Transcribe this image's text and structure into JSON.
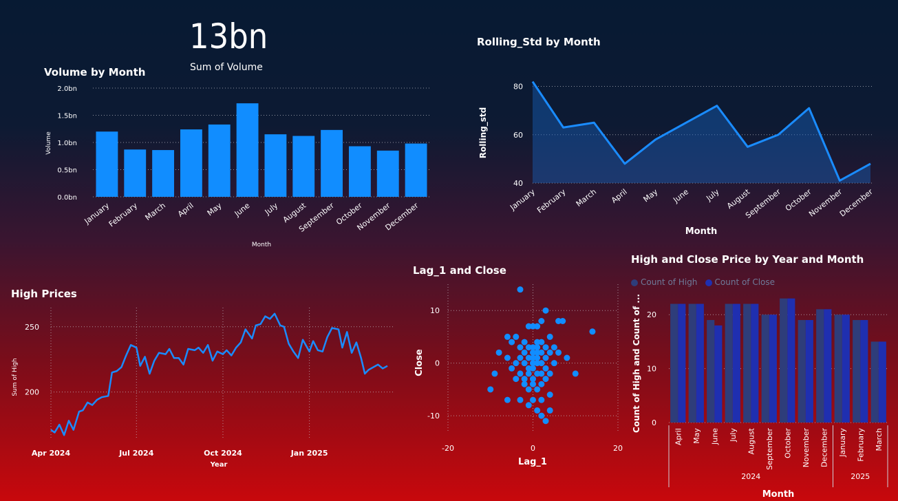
{
  "card": {
    "value": "13bn",
    "label": "Sum of Volume"
  },
  "volume_chart": {
    "title": "Volume by Month",
    "xlabel": "Month",
    "ylabel": "Volume",
    "yticks": [
      "0.0bn",
      "0.5bn",
      "1.0bn",
      "1.5bn",
      "2.0bn"
    ]
  },
  "rolling_chart": {
    "title": "Rolling_Std by Month",
    "xlabel": "Month",
    "ylabel": "Rolling_std",
    "yticks": [
      "40",
      "60",
      "80"
    ]
  },
  "high_chart": {
    "title": "High Prices",
    "xlabel": "Year",
    "ylabel": "Sum of High",
    "yticks": [
      "200",
      "250"
    ],
    "xticks": [
      "Apr 2024",
      "Jul 2024",
      "Oct 2024",
      "Jan 2025"
    ]
  },
  "scatter_chart": {
    "title": "Lag_1 and Close",
    "xlabel": "Lag_1",
    "ylabel": "Close",
    "yticks": [
      "10",
      "0",
      "-10"
    ],
    "xticks": [
      "-20",
      "0",
      "20"
    ]
  },
  "hc_chart": {
    "title": "High and Close Price by Year and Month",
    "xlabel": "Month",
    "ylabel": "Count of High and Count of ...",
    "legend": [
      "Count of High",
      "Count of Close"
    ],
    "yticks": [
      "0",
      "10",
      "20"
    ],
    "years": [
      "2024",
      "2025"
    ]
  },
  "colors": {
    "bar": "#118dff",
    "high": "#2e3d7a",
    "close": "#1f2fb0"
  },
  "chart_data": [
    {
      "type": "bar",
      "title": "Volume by Month",
      "categories": [
        "January",
        "February",
        "March",
        "April",
        "May",
        "June",
        "July",
        "August",
        "September",
        "October",
        "November",
        "December"
      ],
      "values": [
        1.2,
        0.87,
        0.86,
        1.24,
        1.33,
        1.72,
        1.15,
        1.12,
        1.23,
        0.93,
        0.85,
        0.98
      ],
      "xlabel": "Month",
      "ylabel": "Volume",
      "ylim": [
        0,
        2.0
      ],
      "unit": "bn"
    },
    {
      "type": "area",
      "title": "Rolling_Std by Month",
      "categories": [
        "January",
        "February",
        "March",
        "April",
        "May",
        "June",
        "July",
        "August",
        "September",
        "October",
        "November",
        "December"
      ],
      "values": [
        82,
        63,
        65,
        48,
        58,
        65,
        72,
        55,
        60,
        71,
        41,
        48
      ],
      "xlabel": "Month",
      "ylabel": "Rolling_std",
      "ylim": [
        40,
        85
      ]
    },
    {
      "type": "line",
      "title": "High Prices",
      "x": [
        "2024-04-01",
        "2024-04-05",
        "2024-04-10",
        "2024-04-15",
        "2024-04-20",
        "2024-04-25",
        "2024-05-01",
        "2024-05-05",
        "2024-05-10",
        "2024-05-15",
        "2024-05-20",
        "2024-05-25",
        "2024-06-01",
        "2024-06-05",
        "2024-06-10",
        "2024-06-15",
        "2024-06-20",
        "2024-06-25",
        "2024-07-01",
        "2024-07-05",
        "2024-07-10",
        "2024-07-15",
        "2024-07-20",
        "2024-07-25",
        "2024-08-01",
        "2024-08-05",
        "2024-08-10",
        "2024-08-15",
        "2024-08-20",
        "2024-08-25",
        "2024-09-01",
        "2024-09-05",
        "2024-09-10",
        "2024-09-15",
        "2024-09-20",
        "2024-09-25",
        "2024-10-01",
        "2024-10-05",
        "2024-10-10",
        "2024-10-15",
        "2024-10-20",
        "2024-10-25",
        "2024-11-01",
        "2024-11-05",
        "2024-11-10",
        "2024-11-15",
        "2024-11-20",
        "2024-11-25",
        "2024-12-01",
        "2024-12-05",
        "2024-12-10",
        "2024-12-15",
        "2024-12-20",
        "2024-12-25",
        "2025-01-01",
        "2025-01-05",
        "2025-01-10",
        "2025-01-15",
        "2025-01-20",
        "2025-01-25",
        "2025-02-01",
        "2025-02-05",
        "2025-02-10",
        "2025-02-15",
        "2025-02-20",
        "2025-02-25",
        "2025-03-01",
        "2025-03-05",
        "2025-03-10",
        "2025-03-15",
        "2025-03-20",
        "2025-03-25"
      ],
      "y": [
        171,
        169,
        175,
        167,
        178,
        171,
        185,
        186,
        192,
        190,
        194,
        196,
        197,
        215,
        216,
        219,
        228,
        236,
        234,
        220,
        227,
        214,
        224,
        230,
        229,
        233,
        226,
        226,
        221,
        233,
        232,
        234,
        230,
        236,
        224,
        231,
        229,
        232,
        228,
        234,
        238,
        248,
        241,
        251,
        252,
        258,
        256,
        260,
        251,
        250,
        237,
        231,
        226,
        240,
        231,
        239,
        232,
        231,
        242,
        249,
        248,
        234,
        246,
        230,
        238,
        226,
        214,
        217,
        219,
        221,
        218,
        220
      ],
      "xlabel": "Year",
      "ylabel": "Sum of High",
      "ylim": [
        165,
        262
      ]
    },
    {
      "type": "scatter",
      "title": "Lag_1 and Close",
      "points": [
        [
          -3,
          14
        ],
        [
          3,
          10
        ],
        [
          2,
          8
        ],
        [
          6,
          8
        ],
        [
          -1,
          7
        ],
        [
          0,
          7
        ],
        [
          1,
          7
        ],
        [
          4,
          5
        ],
        [
          -4,
          5
        ],
        [
          -5,
          4
        ],
        [
          -2,
          4
        ],
        [
          1,
          4
        ],
        [
          2,
          4
        ],
        [
          3,
          3
        ],
        [
          -3,
          3
        ],
        [
          -1,
          3
        ],
        [
          0,
          3
        ],
        [
          1,
          3
        ],
        [
          5,
          3
        ],
        [
          6,
          2
        ],
        [
          -2,
          2
        ],
        [
          0,
          2
        ],
        [
          1,
          2
        ],
        [
          2,
          2
        ],
        [
          4,
          2
        ],
        [
          -6,
          1
        ],
        [
          -3,
          1
        ],
        [
          -1,
          1
        ],
        [
          0,
          1
        ],
        [
          1,
          1
        ],
        [
          3,
          1
        ],
        [
          -4,
          0
        ],
        [
          -2,
          0
        ],
        [
          0,
          0
        ],
        [
          1,
          0
        ],
        [
          2,
          0
        ],
        [
          5,
          0
        ],
        [
          -5,
          -1
        ],
        [
          -1,
          -1
        ],
        [
          0,
          -1
        ],
        [
          3,
          -1
        ],
        [
          -3,
          -2
        ],
        [
          -1,
          -2
        ],
        [
          1,
          -2
        ],
        [
          2,
          -2
        ],
        [
          4,
          -2
        ],
        [
          -4,
          -3
        ],
        [
          -2,
          -3
        ],
        [
          0,
          -3
        ],
        [
          3,
          -3
        ],
        [
          -2,
          -4
        ],
        [
          0,
          -4
        ],
        [
          2,
          -4
        ],
        [
          -1,
          -5
        ],
        [
          1,
          -5
        ],
        [
          4,
          -6
        ],
        [
          -3,
          -7
        ],
        [
          0,
          -7
        ],
        [
          2,
          -7
        ],
        [
          -6,
          -7
        ],
        [
          -1,
          -8
        ],
        [
          1,
          -9
        ],
        [
          4,
          -9
        ],
        [
          3,
          -11
        ],
        [
          2,
          -10
        ],
        [
          -10,
          -5
        ],
        [
          -9,
          -2
        ],
        [
          -8,
          2
        ],
        [
          -6,
          5
        ],
        [
          8,
          1
        ],
        [
          10,
          -2
        ],
        [
          14,
          6
        ],
        [
          7,
          8
        ]
      ],
      "xlabel": "Lag_1",
      "ylabel": "Close",
      "xlim": [
        -20,
        20
      ],
      "ylim": [
        -13,
        15
      ]
    },
    {
      "type": "bar",
      "title": "High and Close Price by Year and Month",
      "categories": [
        "April",
        "May",
        "June",
        "July",
        "August",
        "September",
        "October",
        "November",
        "December",
        "January",
        "February",
        "March"
      ],
      "groups": [
        {
          "name": "2024",
          "count": 9
        },
        {
          "name": "2025",
          "count": 3
        }
      ],
      "series": [
        {
          "name": "Count of High",
          "values": [
            22,
            22,
            19,
            22,
            22,
            20,
            23,
            19,
            21,
            20,
            19,
            15
          ]
        },
        {
          "name": "Count of Close",
          "values": [
            22,
            22,
            18,
            22,
            22,
            20,
            23,
            19,
            21,
            20,
            19,
            15
          ]
        }
      ],
      "xlabel": "Month",
      "ylabel": "Count of High and Count of ...",
      "ylim": [
        0,
        25
      ]
    }
  ]
}
